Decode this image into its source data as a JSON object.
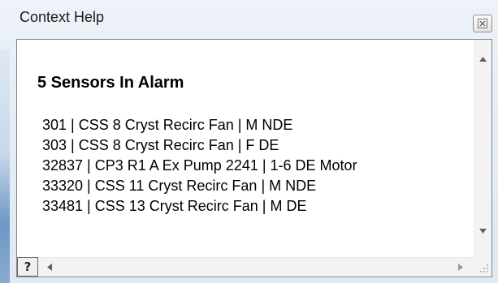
{
  "window": {
    "title": "Context Help"
  },
  "content": {
    "heading": "5 Sensors In Alarm",
    "sensors": [
      "301 | CSS 8 Cryst Recirc Fan | M NDE",
      "303 | CSS 8 Cryst Recirc Fan | F DE",
      "32837 | CP3 R1 A Ex Pump 2241 | 1-6 DE Motor",
      "33320 | CSS 11 Cryst Recirc Fan | M NDE",
      "33481 | CSS 13 Cryst Recirc Fan | M DE"
    ]
  },
  "help_button": {
    "glyph": "?"
  },
  "icons": {
    "close": "close-icon",
    "scroll_up": "scroll-up-arrow-icon",
    "scroll_down": "scroll-down-arrow-icon",
    "scroll_left": "scroll-left-arrow-icon",
    "scroll_right": "scroll-right-arrow-icon",
    "resize_grip": "resize-grip-icon"
  }
}
